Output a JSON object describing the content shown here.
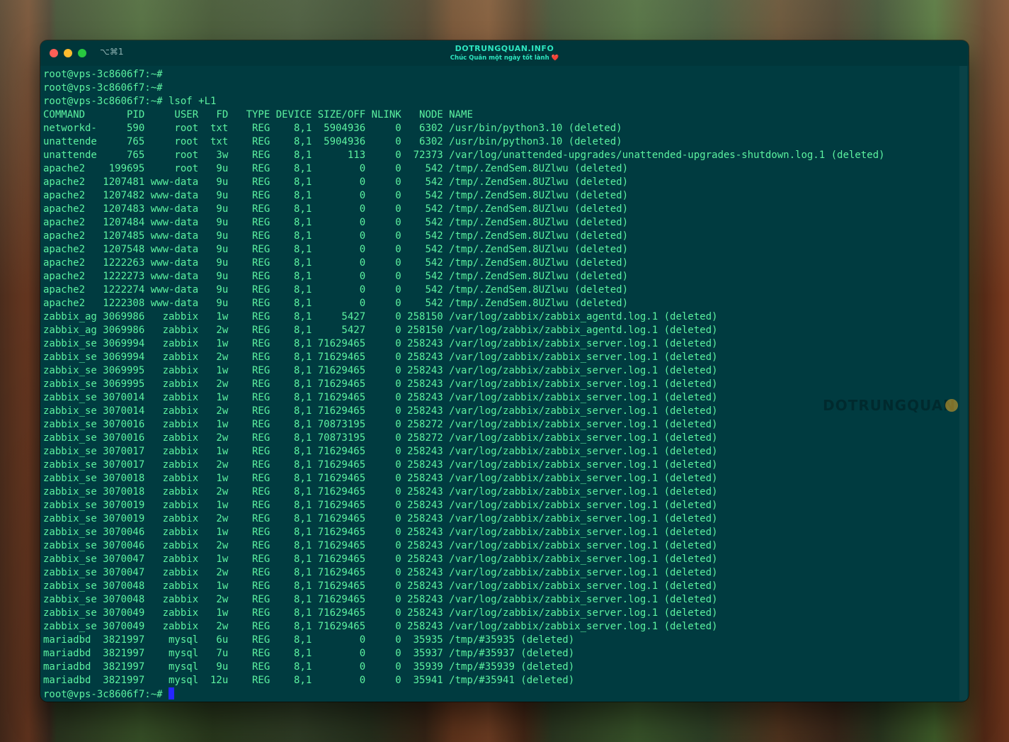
{
  "window": {
    "shortcut": "⌥⌘1",
    "title": "DOTRUNGQUAN.INFO",
    "subtitle": "Chúc Quân một ngày tốt lành ❤️",
    "watermark": "DOTRUNGQUAN"
  },
  "colors": {
    "terminal_bg": "#003b40",
    "terminal_text": "#5cf2a0",
    "title_text": "#2ee6c0",
    "cursor": "#2626ff"
  },
  "terminal": {
    "prompt_final": "root@vps-3c8606f7:~# ",
    "lines": [
      "root@vps-3c8606f7:~#",
      "root@vps-3c8606f7:~#",
      "root@vps-3c8606f7:~# lsof +L1",
      "COMMAND       PID     USER   FD   TYPE DEVICE SIZE/OFF NLINK   NODE NAME",
      "networkd-     590     root  txt    REG    8,1  5904936     0   6302 /usr/bin/python3.10 (deleted)",
      "unattende     765     root  txt    REG    8,1  5904936     0   6302 /usr/bin/python3.10 (deleted)",
      "unattende     765     root   3w    REG    8,1      113     0  72373 /var/log/unattended-upgrades/unattended-upgrades-shutdown.log.1 (deleted)",
      "apache2    199695     root   9u    REG    8,1        0     0    542 /tmp/.ZendSem.8UZlwu (deleted)",
      "apache2   1207481 www-data   9u    REG    8,1        0     0    542 /tmp/.ZendSem.8UZlwu (deleted)",
      "apache2   1207482 www-data   9u    REG    8,1        0     0    542 /tmp/.ZendSem.8UZlwu (deleted)",
      "apache2   1207483 www-data   9u    REG    8,1        0     0    542 /tmp/.ZendSem.8UZlwu (deleted)",
      "apache2   1207484 www-data   9u    REG    8,1        0     0    542 /tmp/.ZendSem.8UZlwu (deleted)",
      "apache2   1207485 www-data   9u    REG    8,1        0     0    542 /tmp/.ZendSem.8UZlwu (deleted)",
      "apache2   1207548 www-data   9u    REG    8,1        0     0    542 /tmp/.ZendSem.8UZlwu (deleted)",
      "apache2   1222263 www-data   9u    REG    8,1        0     0    542 /tmp/.ZendSem.8UZlwu (deleted)",
      "apache2   1222273 www-data   9u    REG    8,1        0     0    542 /tmp/.ZendSem.8UZlwu (deleted)",
      "apache2   1222274 www-data   9u    REG    8,1        0     0    542 /tmp/.ZendSem.8UZlwu (deleted)",
      "apache2   1222308 www-data   9u    REG    8,1        0     0    542 /tmp/.ZendSem.8UZlwu (deleted)",
      "zabbix_ag 3069986   zabbix   1w    REG    8,1     5427     0 258150 /var/log/zabbix/zabbix_agentd.log.1 (deleted)",
      "zabbix_ag 3069986   zabbix   2w    REG    8,1     5427     0 258150 /var/log/zabbix/zabbix_agentd.log.1 (deleted)",
      "zabbix_se 3069994   zabbix   1w    REG    8,1 71629465     0 258243 /var/log/zabbix/zabbix_server.log.1 (deleted)",
      "zabbix_se 3069994   zabbix   2w    REG    8,1 71629465     0 258243 /var/log/zabbix/zabbix_server.log.1 (deleted)",
      "zabbix_se 3069995   zabbix   1w    REG    8,1 71629465     0 258243 /var/log/zabbix/zabbix_server.log.1 (deleted)",
      "zabbix_se 3069995   zabbix   2w    REG    8,1 71629465     0 258243 /var/log/zabbix/zabbix_server.log.1 (deleted)",
      "zabbix_se 3070014   zabbix   1w    REG    8,1 71629465     0 258243 /var/log/zabbix/zabbix_server.log.1 (deleted)",
      "zabbix_se 3070014   zabbix   2w    REG    8,1 71629465     0 258243 /var/log/zabbix/zabbix_server.log.1 (deleted)",
      "zabbix_se 3070016   zabbix   1w    REG    8,1 70873195     0 258272 /var/log/zabbix/zabbix_server.log.1 (deleted)",
      "zabbix_se 3070016   zabbix   2w    REG    8,1 70873195     0 258272 /var/log/zabbix/zabbix_server.log.1 (deleted)",
      "zabbix_se 3070017   zabbix   1w    REG    8,1 71629465     0 258243 /var/log/zabbix/zabbix_server.log.1 (deleted)",
      "zabbix_se 3070017   zabbix   2w    REG    8,1 71629465     0 258243 /var/log/zabbix/zabbix_server.log.1 (deleted)",
      "zabbix_se 3070018   zabbix   1w    REG    8,1 71629465     0 258243 /var/log/zabbix/zabbix_server.log.1 (deleted)",
      "zabbix_se 3070018   zabbix   2w    REG    8,1 71629465     0 258243 /var/log/zabbix/zabbix_server.log.1 (deleted)",
      "zabbix_se 3070019   zabbix   1w    REG    8,1 71629465     0 258243 /var/log/zabbix/zabbix_server.log.1 (deleted)",
      "zabbix_se 3070019   zabbix   2w    REG    8,1 71629465     0 258243 /var/log/zabbix/zabbix_server.log.1 (deleted)",
      "zabbix_se 3070046   zabbix   1w    REG    8,1 71629465     0 258243 /var/log/zabbix/zabbix_server.log.1 (deleted)",
      "zabbix_se 3070046   zabbix   2w    REG    8,1 71629465     0 258243 /var/log/zabbix/zabbix_server.log.1 (deleted)",
      "zabbix_se 3070047   zabbix   1w    REG    8,1 71629465     0 258243 /var/log/zabbix/zabbix_server.log.1 (deleted)",
      "zabbix_se 3070047   zabbix   2w    REG    8,1 71629465     0 258243 /var/log/zabbix/zabbix_server.log.1 (deleted)",
      "zabbix_se 3070048   zabbix   1w    REG    8,1 71629465     0 258243 /var/log/zabbix/zabbix_server.log.1 (deleted)",
      "zabbix_se 3070048   zabbix   2w    REG    8,1 71629465     0 258243 /var/log/zabbix/zabbix_server.log.1 (deleted)",
      "zabbix_se 3070049   zabbix   1w    REG    8,1 71629465     0 258243 /var/log/zabbix/zabbix_server.log.1 (deleted)",
      "zabbix_se 3070049   zabbix   2w    REG    8,1 71629465     0 258243 /var/log/zabbix/zabbix_server.log.1 (deleted)",
      "mariadbd  3821997    mysql   6u    REG    8,1        0     0  35935 /tmp/#35935 (deleted)",
      "mariadbd  3821997    mysql   7u    REG    8,1        0     0  35937 /tmp/#35937 (deleted)",
      "mariadbd  3821997    mysql   9u    REG    8,1        0     0  35939 /tmp/#35939 (deleted)",
      "mariadbd  3821997    mysql  12u    REG    8,1        0     0  35941 /tmp/#35941 (deleted)"
    ]
  }
}
